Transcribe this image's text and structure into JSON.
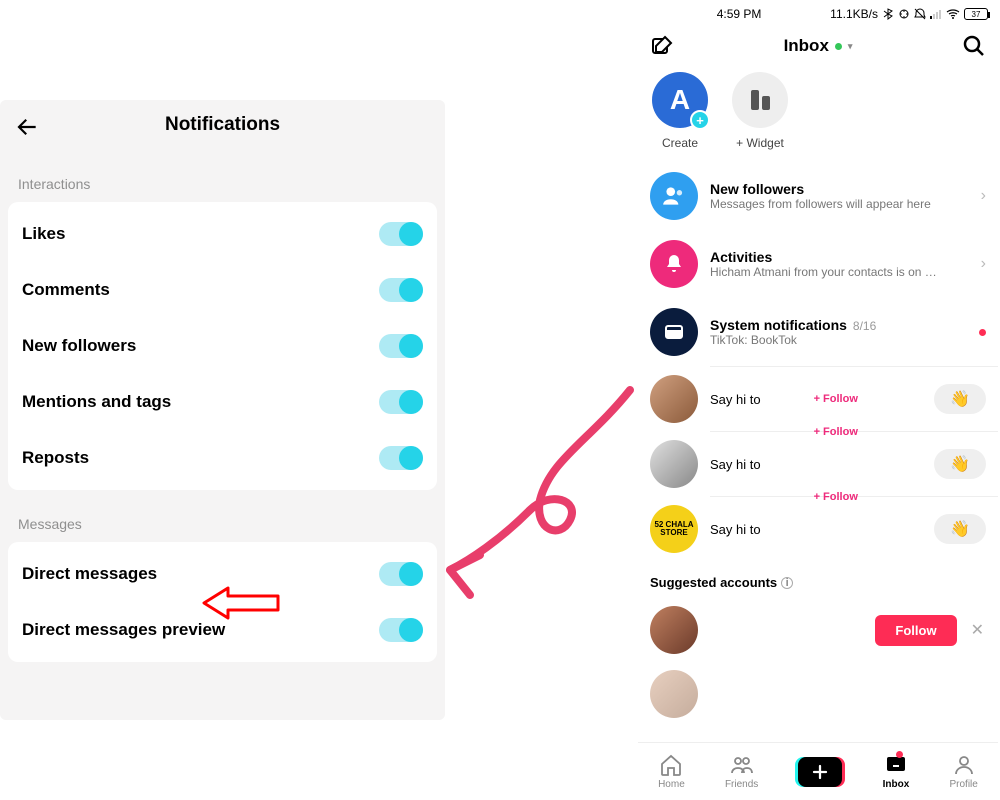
{
  "left": {
    "title": "Notifications",
    "sections": {
      "interactions": {
        "label": "Interactions",
        "items": [
          "Likes",
          "Comments",
          "New followers",
          "Mentions and tags",
          "Reposts"
        ]
      },
      "messages": {
        "label": "Messages",
        "items": [
          "Direct messages",
          "Direct messages preview"
        ]
      }
    }
  },
  "right": {
    "status": {
      "time": "4:59 PM",
      "net": "11.1KB/s",
      "battery": "37"
    },
    "header": {
      "title": "Inbox"
    },
    "top_actions": {
      "create": "Create",
      "widget": "+ Widget",
      "initial": "A"
    },
    "rows": {
      "followers": {
        "title": "New followers",
        "sub": "Messages from followers will appear here"
      },
      "activities": {
        "title": "Activities",
        "sub": "Hicham Atmani from your contacts is on …"
      },
      "system": {
        "title": "System notifications",
        "date": "8/16",
        "sub": "TikTok: BookTok"
      }
    },
    "dm": {
      "sayhi": "Say hi to",
      "follow": "+ Follow",
      "av3_text": "52 CHALA STORE"
    },
    "suggested": {
      "label": "Suggested accounts",
      "follow_btn": "Follow"
    },
    "tabs": {
      "home": "Home",
      "friends": "Friends",
      "inbox": "Inbox",
      "profile": "Profile"
    },
    "wave": "👋"
  }
}
